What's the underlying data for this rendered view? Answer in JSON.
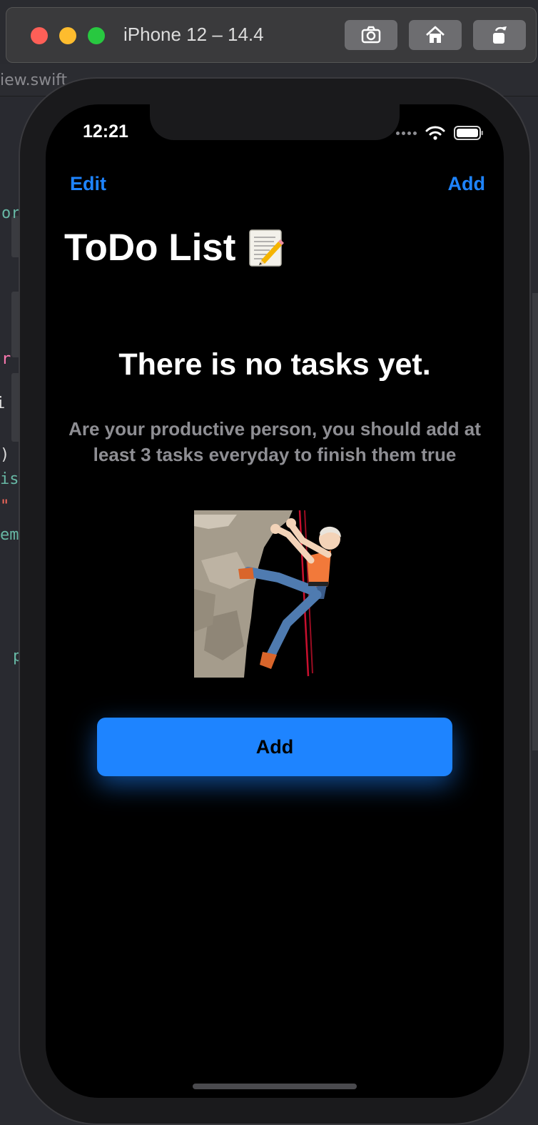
{
  "window": {
    "title": "iPhone 12 – 14.4"
  },
  "editor": {
    "breadcrumb": "iew.swift",
    "fragments": [
      "or",
      "r",
      "i",
      ")",
      "is",
      "\"",
      "ems",
      "p"
    ]
  },
  "status_bar": {
    "time": "12:21"
  },
  "nav": {
    "left_label": "Edit",
    "right_label": "Add"
  },
  "title": "ToDo List",
  "empty_state": {
    "heading": "There is no tasks yet.",
    "description": "Are your productive person, you should add at least 3 tasks everyday to finish them true",
    "button_label": "Add"
  },
  "colors": {
    "accent": "#1e84ff",
    "background": "#000000",
    "secondary_text": "#8e8e93"
  },
  "icons": [
    "screenshot-icon",
    "home-icon",
    "rotate-icon",
    "wifi-icon",
    "battery-icon",
    "memo-icon",
    "climber-illustration"
  ]
}
